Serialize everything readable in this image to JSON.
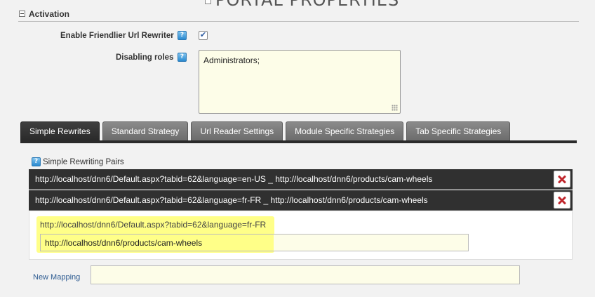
{
  "page": {
    "title": "PORTAL PROPERTIES"
  },
  "section": {
    "title": "Activation"
  },
  "fields": {
    "enable_label": "Enable Friendlier Url Rewriter",
    "enable_checked": true,
    "disabling_label": "Disabling roles",
    "disabling_value": "Administrators;"
  },
  "help_glyph": "?",
  "checkmark": "✔",
  "tabs": [
    {
      "label": "Simple Rewrites",
      "active": true
    },
    {
      "label": "Standard Strategy",
      "active": false
    },
    {
      "label": "Url Reader Settings",
      "active": false
    },
    {
      "label": "Module Specific Strategies",
      "active": false
    },
    {
      "label": "Tab Specific Strategies",
      "active": false
    }
  ],
  "pairs": {
    "label": "Simple Rewriting Pairs",
    "rows": [
      "http://localhost/dnn6/Default.aspx?tabid=62&language=en-US _ http://localhost/dnn6/products/cam-wheels",
      "http://localhost/dnn6/Default.aspx?tabid=62&language=fr-FR _ http://localhost/dnn6/products/cam-wheels"
    ]
  },
  "edit": {
    "source_url": "http://localhost/dnn6/Default.aspx?tabid=62&language=fr-FR",
    "target_url": "http://localhost/dnn6/products/cam-wheels"
  },
  "new_mapping": {
    "label": "New Mapping",
    "value": ""
  },
  "colors": {
    "highlight": "#ffff88",
    "tab_active": "#2f2f2f",
    "tab_inactive": "#7a7a7a",
    "delete": "#c0272d"
  }
}
